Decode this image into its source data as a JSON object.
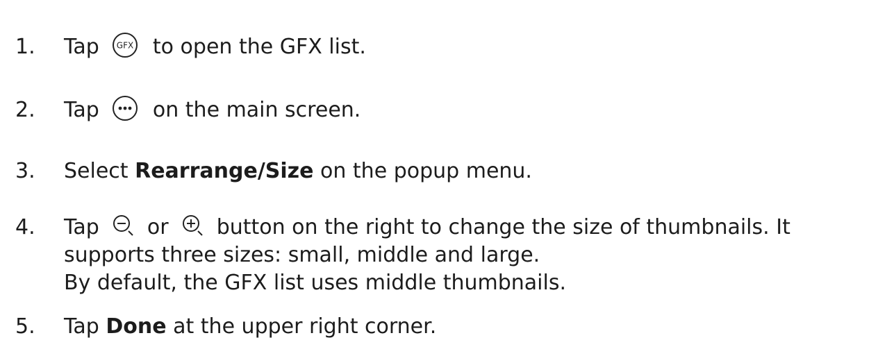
{
  "steps": [
    {
      "number": "1.",
      "before": "Tap",
      "icon": "gfx-circle-icon",
      "icon_text": "GFX",
      "after": "to open the GFX list."
    },
    {
      "number": "2.",
      "before": "Tap",
      "icon": "more-dots-circle-icon",
      "after": "on the main screen."
    },
    {
      "number": "3.",
      "before": "Select",
      "bold": "Rearrange/Size",
      "after": "on the popup menu."
    },
    {
      "number": "4.",
      "before": "Tap",
      "icon_a": "zoom-out-icon",
      "middle": "or",
      "icon_b": "zoom-in-icon",
      "after": "button on the right to change the size of thumbnails. It",
      "line2": "supports three sizes: small, middle and large.",
      "line3": "By default, the GFX list uses middle thumbnails."
    },
    {
      "number": "5.",
      "before": "Tap",
      "bold": "Done",
      "after": "at the upper right corner."
    }
  ]
}
